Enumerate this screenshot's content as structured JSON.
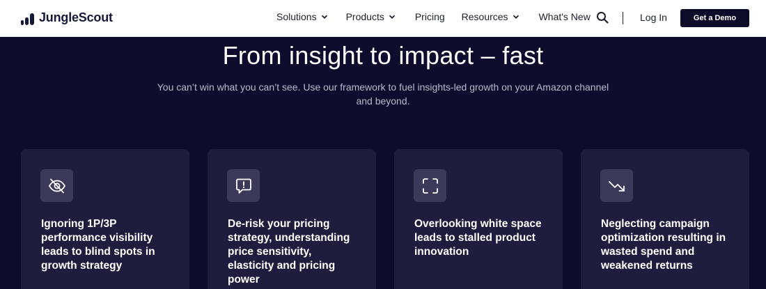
{
  "brand": {
    "name": "JungleScout"
  },
  "nav": {
    "items": [
      {
        "label": "Solutions",
        "dropdown": true
      },
      {
        "label": "Products",
        "dropdown": true
      },
      {
        "label": "Pricing",
        "dropdown": false
      },
      {
        "label": "Resources",
        "dropdown": true
      },
      {
        "label": "What's New",
        "dropdown": false
      }
    ],
    "login": "Log In",
    "demo": "Get a Demo"
  },
  "hero": {
    "title": "From insight to impact – fast",
    "subtitle": "You can’t win what you can’t see. Use our framework to fuel insights-led growth on your Amazon channel and beyond."
  },
  "cards": [
    {
      "icon": "eye-off-icon",
      "text": "Ignoring 1P/3P performance visibility leads to blind spots in growth strategy"
    },
    {
      "icon": "alert-message-icon",
      "text": "De-risk your pricing strategy, understanding price sensitivity, elasticity and pricing power"
    },
    {
      "icon": "frame-corners-icon",
      "text": "Overlooking white space leads to stalled product innovation"
    },
    {
      "icon": "trending-down-icon",
      "text": "Neglecting campaign optimization resulting in wasted spend and weakened returns"
    }
  ],
  "colors": {
    "hero_bg": "#0e0c2c",
    "card_bg": "#1f1d3d",
    "icon_bg": "#3c3a5a",
    "button_bg": "#0c0c28"
  }
}
